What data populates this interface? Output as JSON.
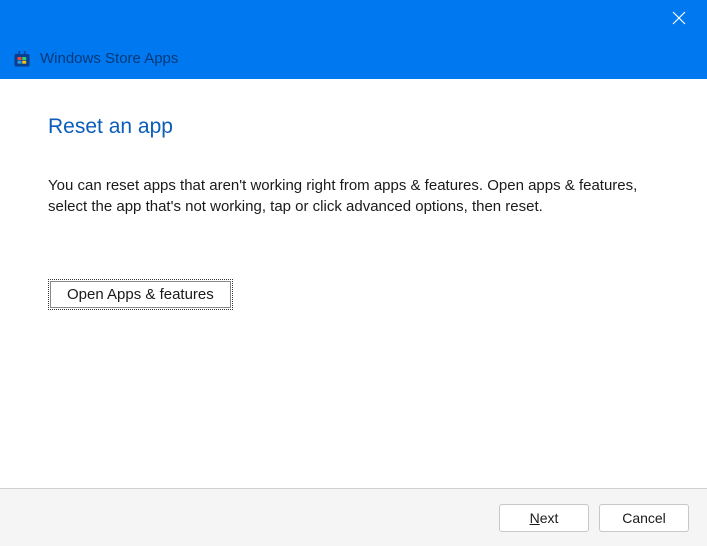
{
  "header": {
    "title": "Windows Store Apps",
    "close_label": "Close"
  },
  "page": {
    "title": "Reset an app",
    "body": "You can reset apps that aren't working right from apps & features. Open apps & features, select the app that's not working, tap or click advanced options, then reset.",
    "action_button": "Open Apps & features"
  },
  "footer": {
    "next_mnemonic": "N",
    "next_rest": "ext",
    "cancel": "Cancel"
  },
  "colors": {
    "accent": "#0078f0",
    "title_blue": "#0a5db9"
  }
}
